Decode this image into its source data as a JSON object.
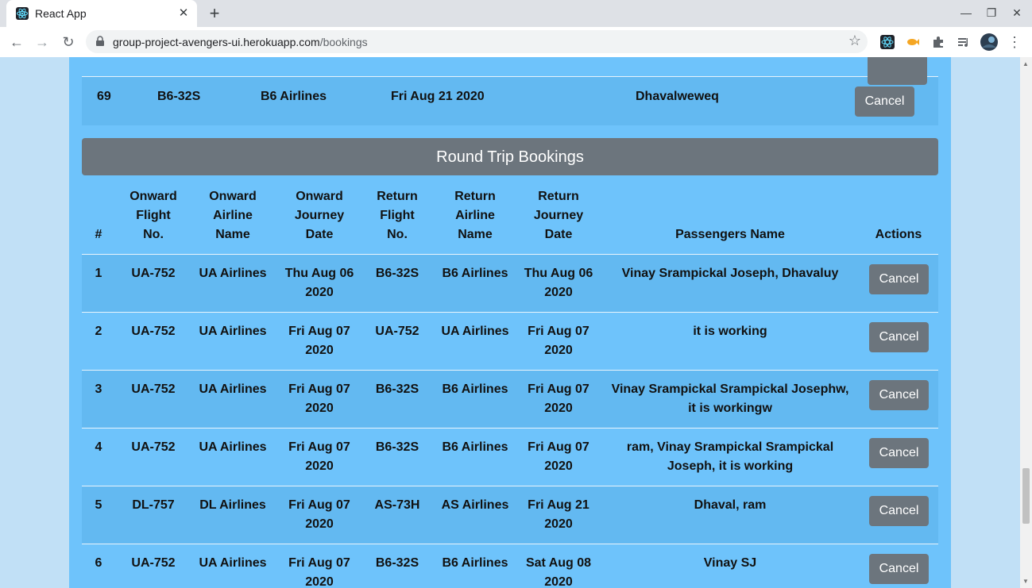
{
  "browser": {
    "tab_title": "React App",
    "url_host": "group-project-avengers-ui.herokuapp.com",
    "url_path": "/bookings"
  },
  "one_way_last_row": {
    "id": "69",
    "flight_no": "B6-32S",
    "airline": "B6 Airlines",
    "date": "Fri Aug 21 2020",
    "passenger": "Dhavalweweq",
    "action": "Cancel"
  },
  "round_trip": {
    "title": "Round Trip Bookings",
    "headers": {
      "idx": "#",
      "onward_flight": "Onward Flight No.",
      "onward_airline": "Onward Airline Name",
      "onward_date": "Onward Journey Date",
      "return_flight": "Return Flight No.",
      "return_airline": "Return Airline Name",
      "return_date": "Return Journey Date",
      "passengers": "Passengers Name",
      "actions": "Actions"
    },
    "rows": [
      {
        "idx": "1",
        "of": "UA-752",
        "oa": "UA Airlines",
        "od": "Thu Aug 06 2020",
        "rf": "B6-32S",
        "ra": "B6 Airlines",
        "rd": "Thu Aug 06 2020",
        "p": "Vinay Srampickal Joseph, Dhavaluy",
        "action": "Cancel"
      },
      {
        "idx": "2",
        "of": "UA-752",
        "oa": "UA Airlines",
        "od": "Fri Aug 07 2020",
        "rf": "UA-752",
        "ra": "UA Airlines",
        "rd": "Fri Aug 07 2020",
        "p": "it is working",
        "action": "Cancel"
      },
      {
        "idx": "3",
        "of": "UA-752",
        "oa": "UA Airlines",
        "od": "Fri Aug 07 2020",
        "rf": "B6-32S",
        "ra": "B6 Airlines",
        "rd": "Fri Aug 07 2020",
        "p": "Vinay Srampickal Srampickal Josephw, it is workingw",
        "action": "Cancel"
      },
      {
        "idx": "4",
        "of": "UA-752",
        "oa": "UA Airlines",
        "od": "Fri Aug 07 2020",
        "rf": "B6-32S",
        "ra": "B6 Airlines",
        "rd": "Fri Aug 07 2020",
        "p": "ram, Vinay Srampickal Srampickal Joseph, it is working",
        "action": "Cancel"
      },
      {
        "idx": "5",
        "of": "DL-757",
        "oa": "DL Airlines",
        "od": "Fri Aug 07 2020",
        "rf": "AS-73H",
        "ra": "AS Airlines",
        "rd": "Fri Aug 21 2020",
        "p": "Dhaval, ram",
        "action": "Cancel"
      },
      {
        "idx": "6",
        "of": "UA-752",
        "oa": "UA Airlines",
        "od": "Fri Aug 07 2020",
        "rf": "B6-32S",
        "ra": "B6 Airlines",
        "rd": "Sat Aug 08 2020",
        "p": "Vinay SJ",
        "action": "Cancel"
      }
    ]
  }
}
